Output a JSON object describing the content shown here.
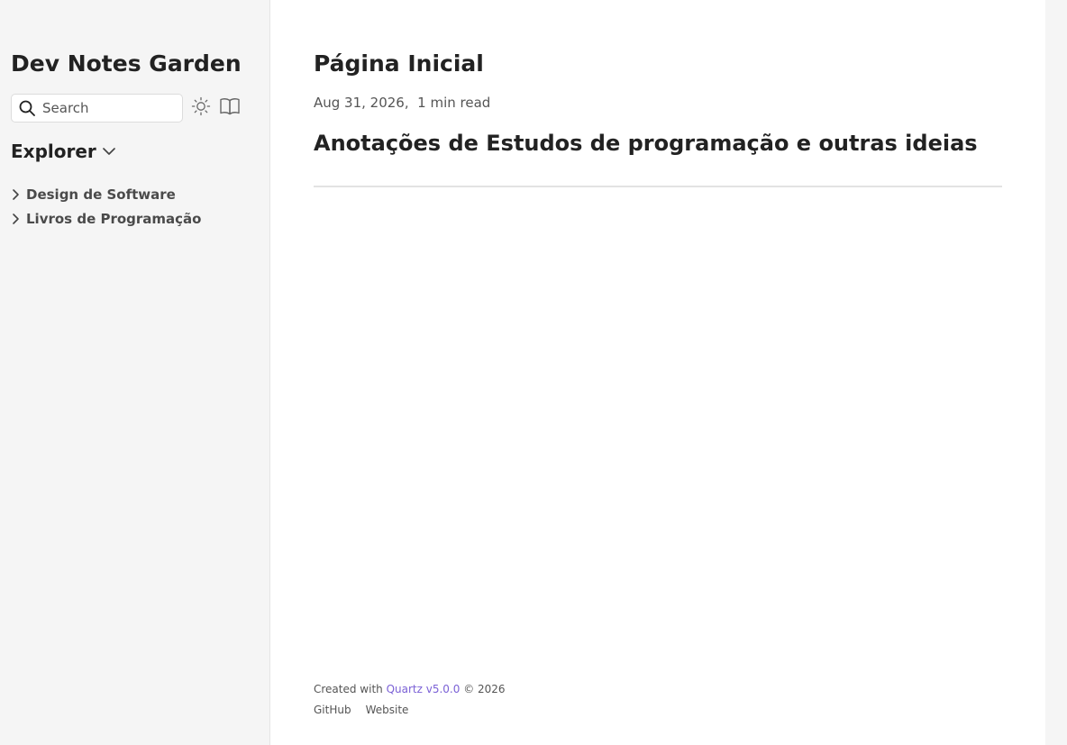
{
  "sidebar": {
    "site_title": "Dev Notes Garden",
    "search": {
      "label": "Search"
    },
    "explorer": {
      "title": "Explorer",
      "folders": [
        {
          "label": "Design de Software"
        },
        {
          "label": "Livros de Programação"
        }
      ]
    }
  },
  "main": {
    "page_title": "Página Inicial",
    "meta": "Aug 31, 2026,  1 min read",
    "heading": "Anotações de Estudos de programação e outras ideias"
  },
  "footer": {
    "created_prefix": "Created with ",
    "quartz_link": "Quartz v5.0.0",
    "created_suffix": " © 2026",
    "links": [
      {
        "label": "GitHub"
      },
      {
        "label": "Website"
      }
    ]
  },
  "colors": {
    "sidebar_bg": "#f5f5f5",
    "accent_link": "#7b61d6",
    "text_dark": "#222222",
    "text_muted": "#555555"
  },
  "icons": {
    "search": "search-icon",
    "theme": "sun-icon",
    "reader": "book-icon",
    "explorer_toggle": "chevron-down-icon",
    "folder_toggle": "chevron-right-icon"
  }
}
